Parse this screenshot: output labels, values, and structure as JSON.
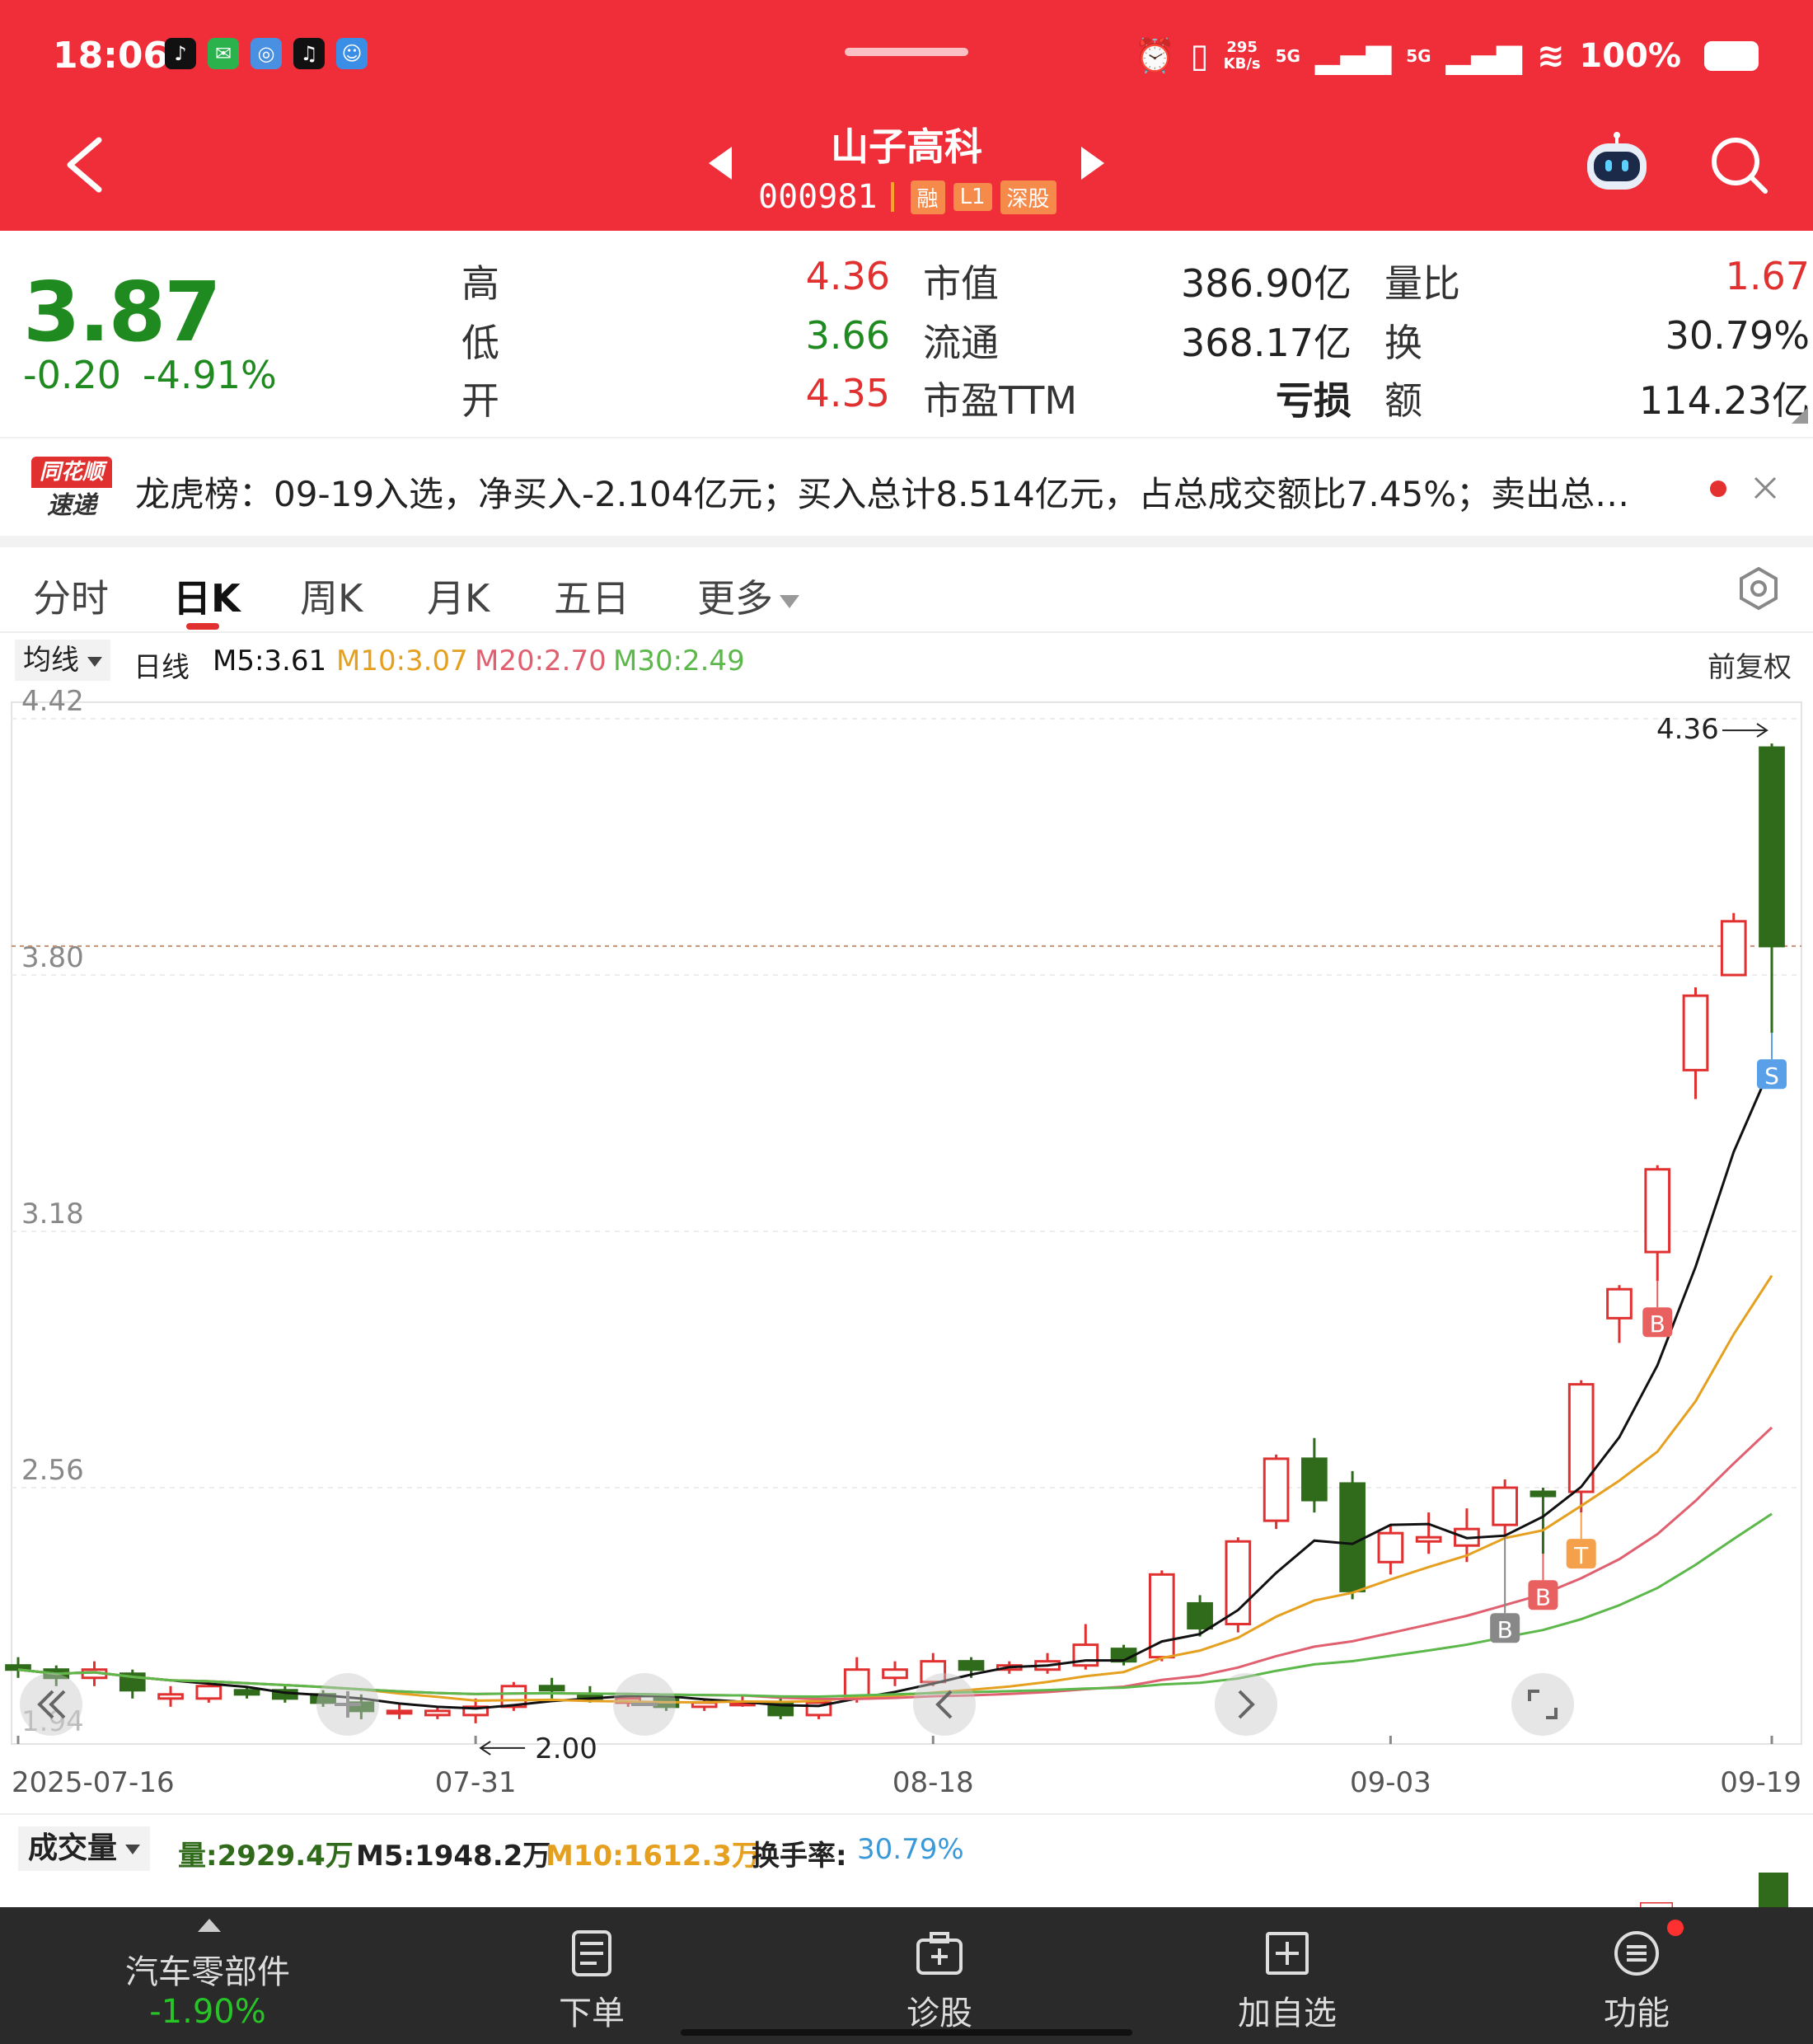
{
  "status_bar": {
    "time": "18:06",
    "net_speed_top": "295",
    "net_speed_unit": "KB/s",
    "signal1": "5G",
    "signal2": "5G",
    "battery": "100%"
  },
  "header": {
    "stock_name": "山子高科",
    "stock_code": "000981",
    "tags": [
      "融",
      "L1",
      "深股"
    ]
  },
  "quote": {
    "price": "3.87",
    "change": "-0.20",
    "change_pct": "-4.91%",
    "rows": [
      {
        "l1": "高",
        "v1": "4.36",
        "l2": "市值",
        "v2": "386.90亿",
        "l3": "量比",
        "v3": "1.67"
      },
      {
        "l1": "低",
        "v1": "3.66",
        "l2": "流通",
        "v2": "368.17亿",
        "l3": "换",
        "v3": "30.79%"
      },
      {
        "l1": "开",
        "v1": "4.35",
        "l2": "市盈TTM",
        "v2": "亏损",
        "l3": "额",
        "v3": "114.23亿"
      }
    ]
  },
  "news": {
    "logo_top": "同花顺",
    "logo_bottom": "速递",
    "text": "龙虎榜：09-19入选，净买入-2.104亿元；买入总计8.514亿元，占总成交额比7.45%；卖出总…"
  },
  "tabs": [
    "分时",
    "日K",
    "周K",
    "月K",
    "五日",
    "更多"
  ],
  "ma_legend": {
    "dropdown": "均线",
    "kline": "日线",
    "m5": "M5:3.61",
    "m10": "M10:3.07",
    "m20": "M20:2.70",
    "m30": "M30:2.49",
    "adjust": "前复权"
  },
  "colors": {
    "brand_red": "#ef2e3a",
    "up": "#e03030",
    "down": "#2f6b1a",
    "m5": "#111111",
    "m10": "#e6a020",
    "m20": "#e06070",
    "m30": "#5cb84a"
  },
  "chart_data": {
    "type": "candlestick",
    "y_ticks": [
      "4.42",
      "3.80",
      "3.18",
      "2.56"
    ],
    "y_bottom_label": "1.94",
    "x_ticks": [
      "2025-07-16",
      "07-31",
      "08-18",
      "09-03",
      "09-19"
    ],
    "ylim": [
      1.94,
      4.42
    ],
    "reference_price": 3.87,
    "max_label": "4.36",
    "min_label": "2.00",
    "candles": [
      [
        2.13,
        2.12,
        2.15,
        2.1
      ],
      [
        2.12,
        2.1,
        2.13,
        2.08
      ],
      [
        2.1,
        2.12,
        2.14,
        2.08
      ],
      [
        2.11,
        2.07,
        2.12,
        2.05
      ],
      [
        2.05,
        2.06,
        2.08,
        2.03
      ],
      [
        2.05,
        2.08,
        2.09,
        2.04
      ],
      [
        2.07,
        2.06,
        2.08,
        2.05
      ],
      [
        2.07,
        2.05,
        2.08,
        2.04
      ],
      [
        2.06,
        2.04,
        2.07,
        2.03
      ],
      [
        2.04,
        2.02,
        2.06,
        2.0
      ],
      [
        2.02,
        2.02,
        2.04,
        2.0
      ],
      [
        2.01,
        2.02,
        2.03,
        2.0
      ],
      [
        2.01,
        2.03,
        2.05,
        1.99
      ],
      [
        2.03,
        2.08,
        2.09,
        2.02
      ],
      [
        2.08,
        2.07,
        2.1,
        2.05
      ],
      [
        2.06,
        2.05,
        2.08,
        2.04
      ],
      [
        2.04,
        2.05,
        2.06,
        2.03
      ],
      [
        2.05,
        2.03,
        2.06,
        2.02
      ],
      [
        2.03,
        2.04,
        2.05,
        2.02
      ],
      [
        2.04,
        2.04,
        2.06,
        2.03
      ],
      [
        2.04,
        2.01,
        2.05,
        2.0
      ],
      [
        2.01,
        2.04,
        2.05,
        2.0
      ],
      [
        2.05,
        2.12,
        2.15,
        2.04
      ],
      [
        2.1,
        2.12,
        2.14,
        2.08
      ],
      [
        2.09,
        2.14,
        2.16,
        2.08
      ],
      [
        2.14,
        2.12,
        2.15,
        2.1
      ],
      [
        2.12,
        2.13,
        2.14,
        2.11
      ],
      [
        2.12,
        2.14,
        2.16,
        2.11
      ],
      [
        2.13,
        2.18,
        2.23,
        2.12
      ],
      [
        2.17,
        2.14,
        2.18,
        2.13
      ],
      [
        2.15,
        2.35,
        2.36,
        2.14
      ],
      [
        2.28,
        2.22,
        2.3,
        2.2
      ],
      [
        2.23,
        2.43,
        2.44,
        2.21
      ],
      [
        2.48,
        2.63,
        2.64,
        2.46
      ],
      [
        2.63,
        2.53,
        2.68,
        2.5
      ],
      [
        2.57,
        2.31,
        2.6,
        2.29
      ],
      [
        2.38,
        2.45,
        2.47,
        2.35
      ],
      [
        2.43,
        2.44,
        2.5,
        2.4
      ],
      [
        2.42,
        2.46,
        2.51,
        2.38
      ],
      [
        2.47,
        2.56,
        2.58,
        2.44
      ],
      [
        2.55,
        2.54,
        2.56,
        2.4
      ],
      [
        2.55,
        2.81,
        2.82,
        2.5
      ],
      [
        2.97,
        3.04,
        3.05,
        2.91
      ],
      [
        3.13,
        3.33,
        3.34,
        3.06
      ],
      [
        3.57,
        3.75,
        3.77,
        3.5
      ],
      [
        3.8,
        3.93,
        3.95,
        3.8
      ],
      [
        4.35,
        3.87,
        4.36,
        3.66
      ]
    ],
    "trade_markers": [
      {
        "label": "S",
        "index": 46
      },
      {
        "label": "B",
        "index": 43
      },
      {
        "label": "B",
        "index": 40
      },
      {
        "label": "B",
        "index": 39
      },
      {
        "label": "T",
        "index": 41
      }
    ]
  },
  "volume": {
    "dropdown": "成交量",
    "vol": "量:2929.4万",
    "m5": "M5:1948.2万",
    "m10": "M10:1612.3万",
    "turnover_label": "换手率:",
    "turnover": "30.79%"
  },
  "bottom_nav": {
    "industry": "汽车零部件",
    "industry_change": "-1.90%",
    "items": [
      "下单",
      "诊股",
      "加自选",
      "功能"
    ]
  }
}
